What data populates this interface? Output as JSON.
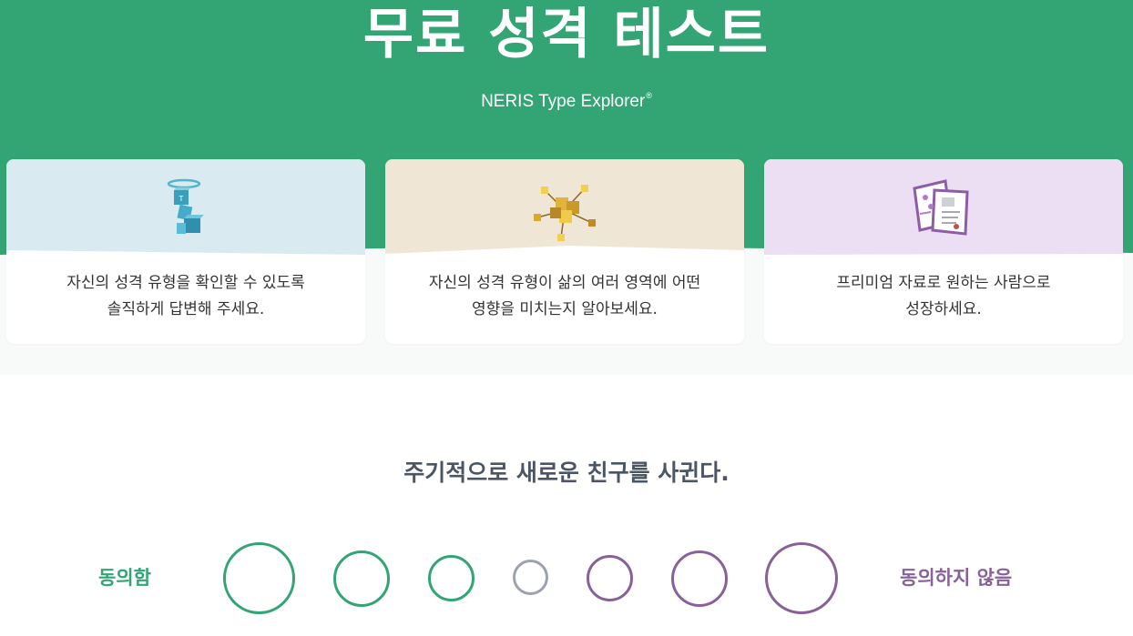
{
  "hero": {
    "title": "무료 성격 테스트",
    "subtitle": "NERIS Type Explorer",
    "subtitle_mark": "®",
    "background_color": "#33a474"
  },
  "cards": [
    {
      "text": "자신의 성격 유형을 확인할 수 있도록\n솔직하게 답변해 주세요.",
      "tint_color": "#d9eaf0",
      "icon": "angel-blocks-icon"
    },
    {
      "text": "자신의 성격 유형이 삶의 여러 영역에 어떤\n영향을 미치는지 알아보세요.",
      "tint_color": "#efe6d5",
      "icon": "connected-cubes-icon"
    },
    {
      "text": "프리미엄 자료로 원하는 사람으로\n성장하세요.",
      "tint_color": "#ecdff3",
      "icon": "documents-icon"
    }
  ],
  "question": {
    "text": "주기적으로 새로운 친구를 사귄다.",
    "agree_label": "동의함",
    "disagree_label": "동의하지 않음",
    "agree_color": "#33a474",
    "neutral_color": "#9ca3af",
    "disagree_color": "#88619a",
    "scale_points": 7,
    "selected": null
  }
}
